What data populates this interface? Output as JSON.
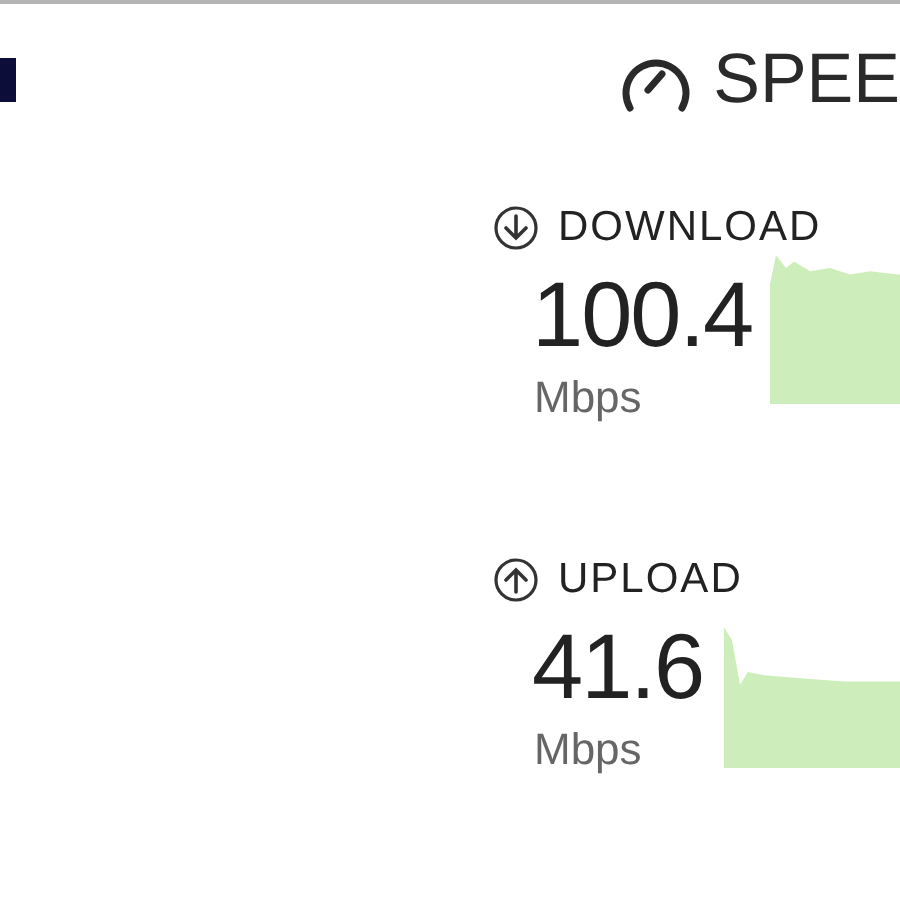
{
  "header": {
    "title": "SPEE"
  },
  "metrics": [
    {
      "kind": "download",
      "label": "DOWNLOAD",
      "value": "100.4",
      "unit": "Mbps"
    },
    {
      "kind": "upload",
      "label": "UPLOAD",
      "value": "41.6",
      "unit": "Mbps"
    }
  ]
}
